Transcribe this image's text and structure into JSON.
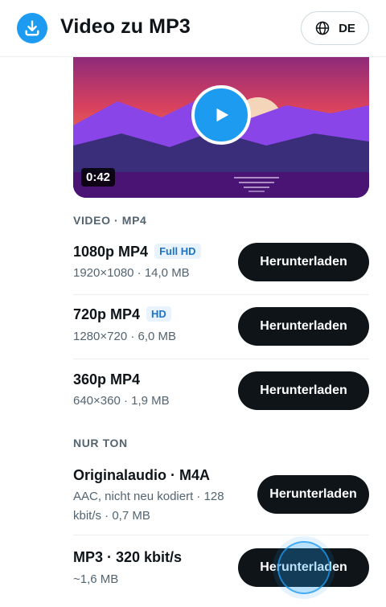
{
  "header": {
    "title": "Video zu MP3",
    "language": "DE"
  },
  "thumbnail": {
    "duration": "0:42"
  },
  "video_section": {
    "title": "VIDEO · MP4",
    "items": [
      {
        "title": "1080p MP4",
        "badge": "Full HD",
        "details": "1920×1080 · 14,0 MB",
        "button": "Herunterladen"
      },
      {
        "title": "720p MP4",
        "badge": "HD",
        "details": "1280×720 · 6,0 MB",
        "button": "Herunterladen"
      },
      {
        "title": "360p MP4",
        "badge": "",
        "details": "640×360 · 1,9 MB",
        "button": "Herunterladen"
      }
    ]
  },
  "audio_section": {
    "title": "NUR TON",
    "items": [
      {
        "title": "Originalaudio · M4A",
        "details": "AAC, nicht neu kodiert · 128 kbit/s · 0,7 MB",
        "button": "Herunterladen"
      },
      {
        "title": "MP3 · 320 kbit/s",
        "details": "~1,6 MB",
        "button": "Herunterladen"
      }
    ]
  },
  "colors": {
    "accent": "#1d9bf0",
    "button_bg": "#0f1419",
    "badge_text": "#1d74c7",
    "badge_bg": "#e8f3fd"
  },
  "icons": {
    "logo": "download-icon",
    "language": "globe-icon",
    "play": "play-icon"
  }
}
